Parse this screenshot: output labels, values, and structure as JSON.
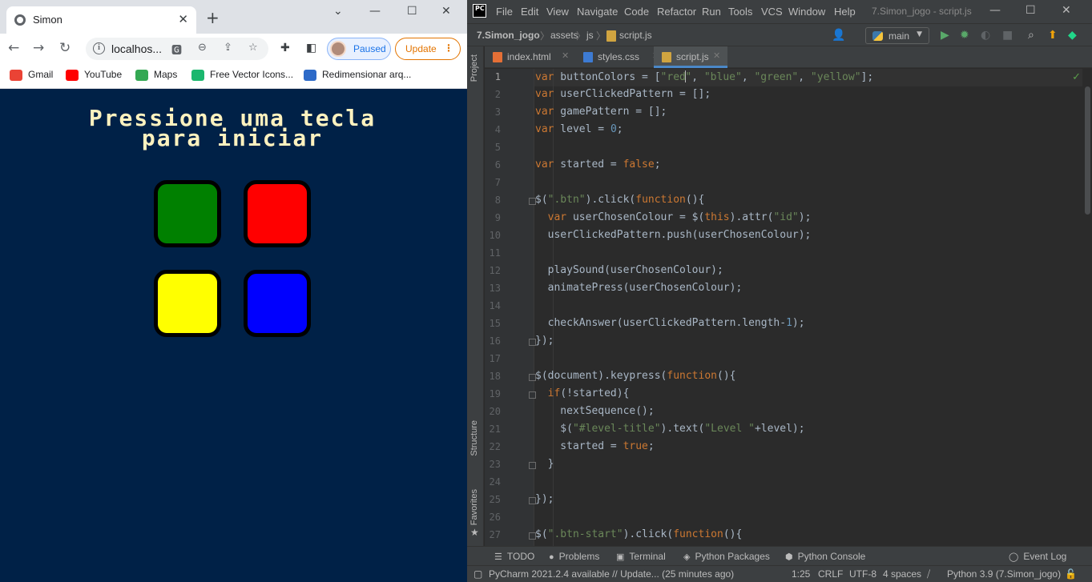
{
  "browser": {
    "tab_title": "Simon",
    "address": "localhos...",
    "profile_label": "Paused",
    "update_label": "Update",
    "bookmarks": [
      "Gmail",
      "YouTube",
      "Maps",
      "Free Vector Icons...",
      "Redimensionar arq..."
    ]
  },
  "simon": {
    "title_line1": "Pressione uma tecla",
    "title_line2": "para iniciar",
    "buttons": [
      {
        "id": "green",
        "color": "#008000"
      },
      {
        "id": "red",
        "color": "#ff0000"
      },
      {
        "id": "yellow",
        "color": "#ffff00"
      },
      {
        "id": "blue",
        "color": "#0000ff"
      }
    ]
  },
  "ide": {
    "menu": [
      "File",
      "Edit",
      "View",
      "Navigate",
      "Code",
      "Refactor",
      "Run",
      "Tools",
      "VCS",
      "Window",
      "Help"
    ],
    "window_title": "7.Simon_jogo - script.js",
    "breadcrumb": [
      "7.Simon_jogo",
      "assets",
      "js",
      "script.js"
    ],
    "branch": "main",
    "tabs": [
      "index.html",
      "styles.css",
      "script.js"
    ],
    "side_labels": [
      "Project",
      "Structure",
      "Favorites"
    ],
    "line_numbers": [
      "1",
      "2",
      "3",
      "4",
      "5",
      "6",
      "7",
      "8",
      "9",
      "10",
      "11",
      "12",
      "13",
      "14",
      "15",
      "16",
      "17",
      "18",
      "19",
      "20",
      "21",
      "22",
      "23",
      "24",
      "25",
      "26",
      "27"
    ],
    "bottom_tools": [
      "TODO",
      "Problems",
      "Terminal",
      "Python Packages",
      "Python Console",
      "Event Log"
    ],
    "status_message": "PyCharm 2021.2.4 available // Update... (25 minutes ago)",
    "status_right": [
      "1:25",
      "CRLF",
      "UTF-8",
      "4 spaces",
      "Python 3.9 (7.Simon_jogo)"
    ]
  },
  "code": {
    "l1": [
      {
        "t": "var",
        "c": "k"
      },
      {
        "t": " buttonColors = [",
        "c": ""
      },
      {
        "t": "\"red\"",
        "c": "s"
      },
      {
        "t": ", ",
        "c": ""
      },
      {
        "t": "\"blue\"",
        "c": "s"
      },
      {
        "t": ", ",
        "c": ""
      },
      {
        "t": "\"green\"",
        "c": "s"
      },
      {
        "t": ", ",
        "c": ""
      },
      {
        "t": "\"yellow\"",
        "c": "s"
      },
      {
        "t": "];",
        "c": ""
      }
    ],
    "l2": [
      {
        "t": "var",
        "c": "k"
      },
      {
        "t": " userClickedPattern = [];",
        "c": ""
      }
    ],
    "l3": [
      {
        "t": "var",
        "c": "k"
      },
      {
        "t": " gamePattern = [];",
        "c": ""
      }
    ],
    "l4": [
      {
        "t": "var",
        "c": "k"
      },
      {
        "t": " level = ",
        "c": ""
      },
      {
        "t": "0",
        "c": "n"
      },
      {
        "t": ";",
        "c": ""
      }
    ],
    "l6": [
      {
        "t": "var",
        "c": "k"
      },
      {
        "t": " started = ",
        "c": ""
      },
      {
        "t": "false",
        "c": "k"
      },
      {
        "t": ";",
        "c": ""
      }
    ],
    "l8": [
      {
        "t": "$(",
        "c": ""
      },
      {
        "t": "\".btn\"",
        "c": "s"
      },
      {
        "t": ").click(",
        "c": ""
      },
      {
        "t": "function",
        "c": "k"
      },
      {
        "t": "(){",
        "c": ""
      }
    ],
    "l9": [
      {
        "t": "  ",
        "c": ""
      },
      {
        "t": "var",
        "c": "k"
      },
      {
        "t": " userChosenColour = $(",
        "c": ""
      },
      {
        "t": "this",
        "c": "k"
      },
      {
        "t": ").attr(",
        "c": ""
      },
      {
        "t": "\"id\"",
        "c": "s"
      },
      {
        "t": ");",
        "c": ""
      }
    ],
    "l10": [
      {
        "t": "  userClickedPattern.push(userChosenColour);",
        "c": ""
      }
    ],
    "l12": [
      {
        "t": "  playSound(userChosenColour);",
        "c": ""
      }
    ],
    "l13": [
      {
        "t": "  animatePress(userChosenColour);",
        "c": ""
      }
    ],
    "l15": [
      {
        "t": "  checkAnswer(userClickedPattern.length-",
        "c": ""
      },
      {
        "t": "1",
        "c": "n"
      },
      {
        "t": ");",
        "c": ""
      }
    ],
    "l16": [
      {
        "t": "});",
        "c": ""
      }
    ],
    "l18": [
      {
        "t": "$(document).keypress(",
        "c": ""
      },
      {
        "t": "function",
        "c": "k"
      },
      {
        "t": "(){",
        "c": ""
      }
    ],
    "l19": [
      {
        "t": "  ",
        "c": ""
      },
      {
        "t": "if",
        "c": "k"
      },
      {
        "t": "(!started){",
        "c": ""
      }
    ],
    "l20": [
      {
        "t": "    nextSequence();",
        "c": ""
      }
    ],
    "l21": [
      {
        "t": "    $(",
        "c": ""
      },
      {
        "t": "\"#level-title\"",
        "c": "s"
      },
      {
        "t": ").text(",
        "c": ""
      },
      {
        "t": "\"Level \"",
        "c": "s"
      },
      {
        "t": "+level);",
        "c": ""
      }
    ],
    "l22": [
      {
        "t": "    started = ",
        "c": ""
      },
      {
        "t": "true",
        "c": "k"
      },
      {
        "t": ";",
        "c": ""
      }
    ],
    "l23": [
      {
        "t": "  }",
        "c": ""
      }
    ],
    "l25": [
      {
        "t": "});",
        "c": ""
      }
    ],
    "l27": [
      {
        "t": "$(",
        "c": ""
      },
      {
        "t": "\".btn-start\"",
        "c": "s"
      },
      {
        "t": ").click(",
        "c": ""
      },
      {
        "t": "function",
        "c": "k"
      },
      {
        "t": "(){",
        "c": ""
      }
    ]
  }
}
